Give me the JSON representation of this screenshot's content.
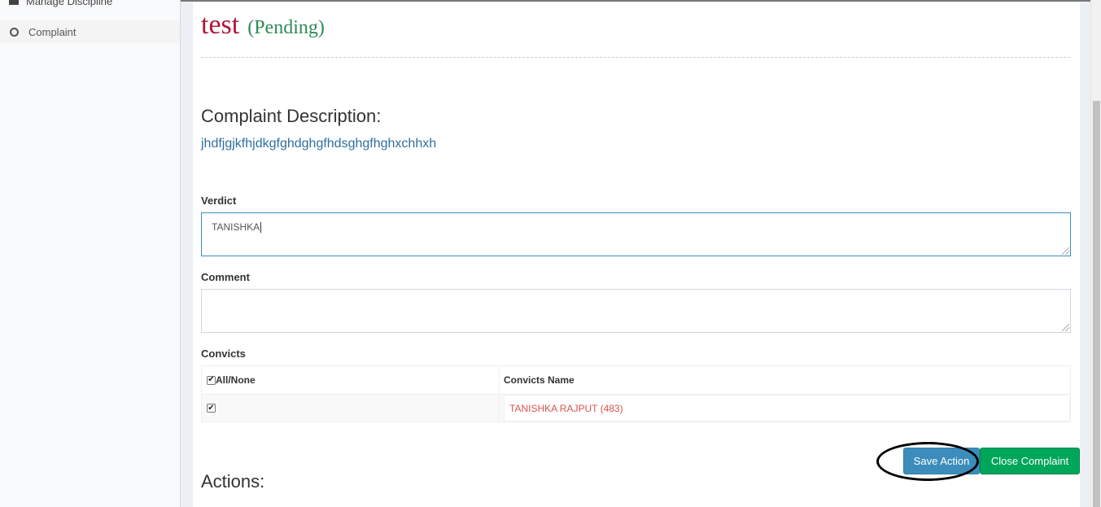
{
  "sidebar": {
    "parent_item": {
      "label": "Manage Discipline",
      "icon": "folder-icon"
    },
    "items": [
      {
        "label": "Complaint",
        "icon": "circle-icon"
      }
    ]
  },
  "complaint": {
    "title": "test",
    "status": "(Pending)",
    "description_heading": "Complaint Description:",
    "description": "jhdfjgjkfhjdkgfghdghgfhdsghgfhghxchhxh"
  },
  "form": {
    "verdict_label": "Verdict",
    "verdict_value": "TANISHKA",
    "comment_label": "Comment",
    "comment_value": "",
    "convicts_label": "Convicts"
  },
  "convicts_table": {
    "headers": [
      "All/None",
      "Convicts Name"
    ],
    "rows": [
      {
        "checked": true,
        "name": "TANISHKA RAJPUT (483)"
      }
    ]
  },
  "buttons": {
    "save_action": "Save Action",
    "close_complaint": "Close Complaint"
  },
  "actions_heading": "Actions:",
  "colors": {
    "title": "#b0153a",
    "status": "#2e8b57",
    "description": "#2f6f9f",
    "save_button": "#3c8dbc",
    "close_button": "#00a65a",
    "convict_name": "#d9534f"
  }
}
